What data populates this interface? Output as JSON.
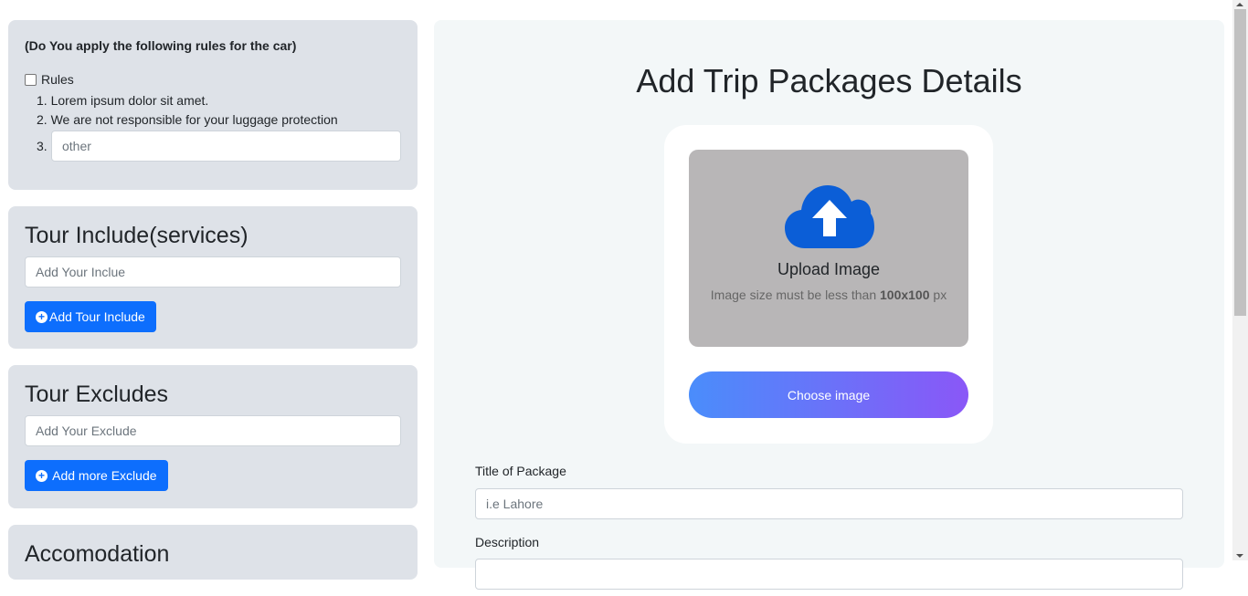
{
  "rules": {
    "title": "(Do You apply the following rules for the car)",
    "checkbox_label": "Rules",
    "checked": false,
    "items": [
      "1. Lorem ipsum dolor sit amet.",
      "2. We are not responsible for your luggage protection"
    ],
    "other_number": "3.",
    "other_placeholder": "other"
  },
  "include": {
    "heading": "Tour Include(services)",
    "placeholder": "Add Your Inclue",
    "button_label": "Add Tour Include"
  },
  "exclude": {
    "heading": "Tour Excludes",
    "placeholder": "Add Your Exclude",
    "button_label": " Add more Exclude"
  },
  "accomodation": {
    "heading": "Accomodation"
  },
  "main": {
    "title": "Add Trip Packages Details",
    "upload_title": "Upload Image",
    "upload_note_prefix": "Image size must be less than ",
    "upload_note_size": "100x100",
    "upload_note_suffix": " px",
    "choose_label": "Choose image",
    "title_label": "Title of Package",
    "title_placeholder": "i.e Lahore",
    "description_label": "Description"
  },
  "colors": {
    "primary": "#0d6efd",
    "card_bg": "#dee2e8",
    "upload_icon": "#0b5ed7",
    "gradient_start": "#4a8dfb",
    "gradient_end": "#8a57f7"
  },
  "icons": {
    "plus": "plus-circle-icon",
    "upload": "cloud-upload-icon"
  }
}
